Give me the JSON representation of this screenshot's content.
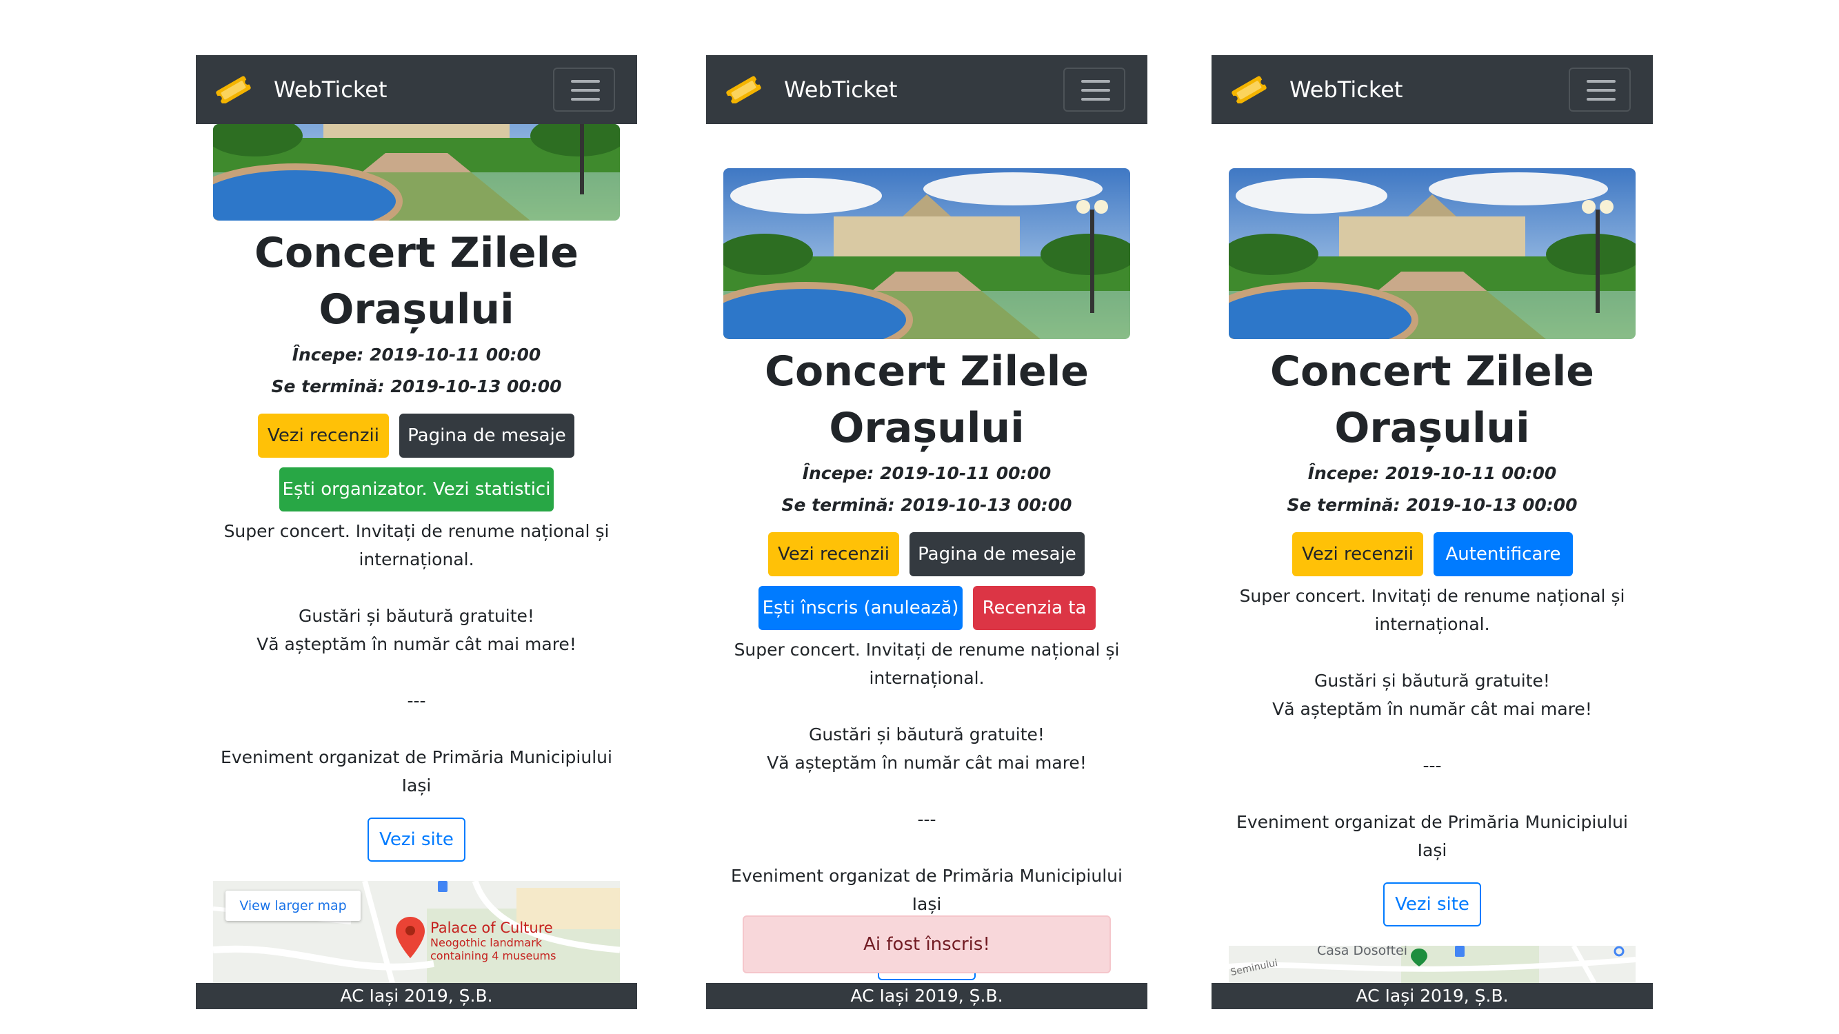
{
  "navbar": {
    "brand": "WebTicket",
    "ticket_icon": "ticket-icon",
    "menu_icon": "hamburger-menu-icon"
  },
  "event": {
    "title_line1": "Concert Zilele",
    "title_line2": "Orașului",
    "start": "Începe: 2019-10-11 00:00",
    "end": "Se termină: 2019-10-13 00:00",
    "description": [
      "Super concert. Invitați de renume național și",
      "internațional.",
      "Gustări și băutură gratuite!",
      "Vă așteptăm în număr cât mai mare!",
      "---",
      "Eveniment organizat de Primăria Municipiului",
      "Iași"
    ]
  },
  "buttons": {
    "reviews": "Vezi recenzii",
    "messages": "Pagina de mesaje",
    "organizer_stats": "Ești organizator. Vezi statistici",
    "enrolled_cancel": "Ești înscris (anulează)",
    "your_review": "Recenzia ta",
    "login": "Autentificare",
    "visit_site": "Vezi site"
  },
  "map": {
    "view_larger": "View larger map",
    "place_name": "Palace of Culture",
    "place_desc1": "Neogothic landmark",
    "place_desc2": "containing 4 museums",
    "poi_label": "Casa Dosoftei",
    "street_label": "Seminului"
  },
  "alert": {
    "enrolled": "Ai fost înscris!"
  },
  "footer": {
    "text": "AC Iași 2019, Ș.B."
  },
  "colors": {
    "navbar": "#343a40",
    "warning": "#ffc107",
    "primary": "#007bff",
    "success": "#28a745",
    "danger": "#dc3545",
    "alert_bg": "#f8d7da",
    "alert_text": "#721c24"
  }
}
